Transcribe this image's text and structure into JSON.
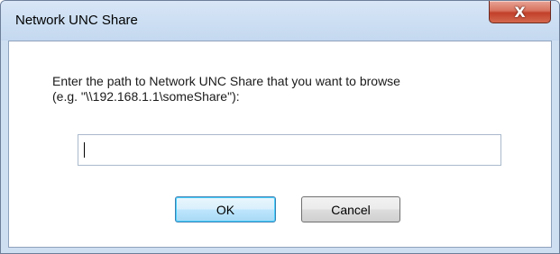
{
  "window": {
    "title": "Network UNC Share",
    "close_glyph": "X"
  },
  "dialog": {
    "prompt_line1": "Enter the path to Network UNC Share that you want to browse",
    "prompt_line2": "(e.g. \"\\\\192.168.1.1\\someShare\"):",
    "path_value": ""
  },
  "buttons": {
    "ok_label": "OK",
    "cancel_label": "Cancel"
  },
  "colors": {
    "titlebar": "#cddff3",
    "close_button": "#c2402a",
    "default_button_border": "#3c7fb1"
  }
}
